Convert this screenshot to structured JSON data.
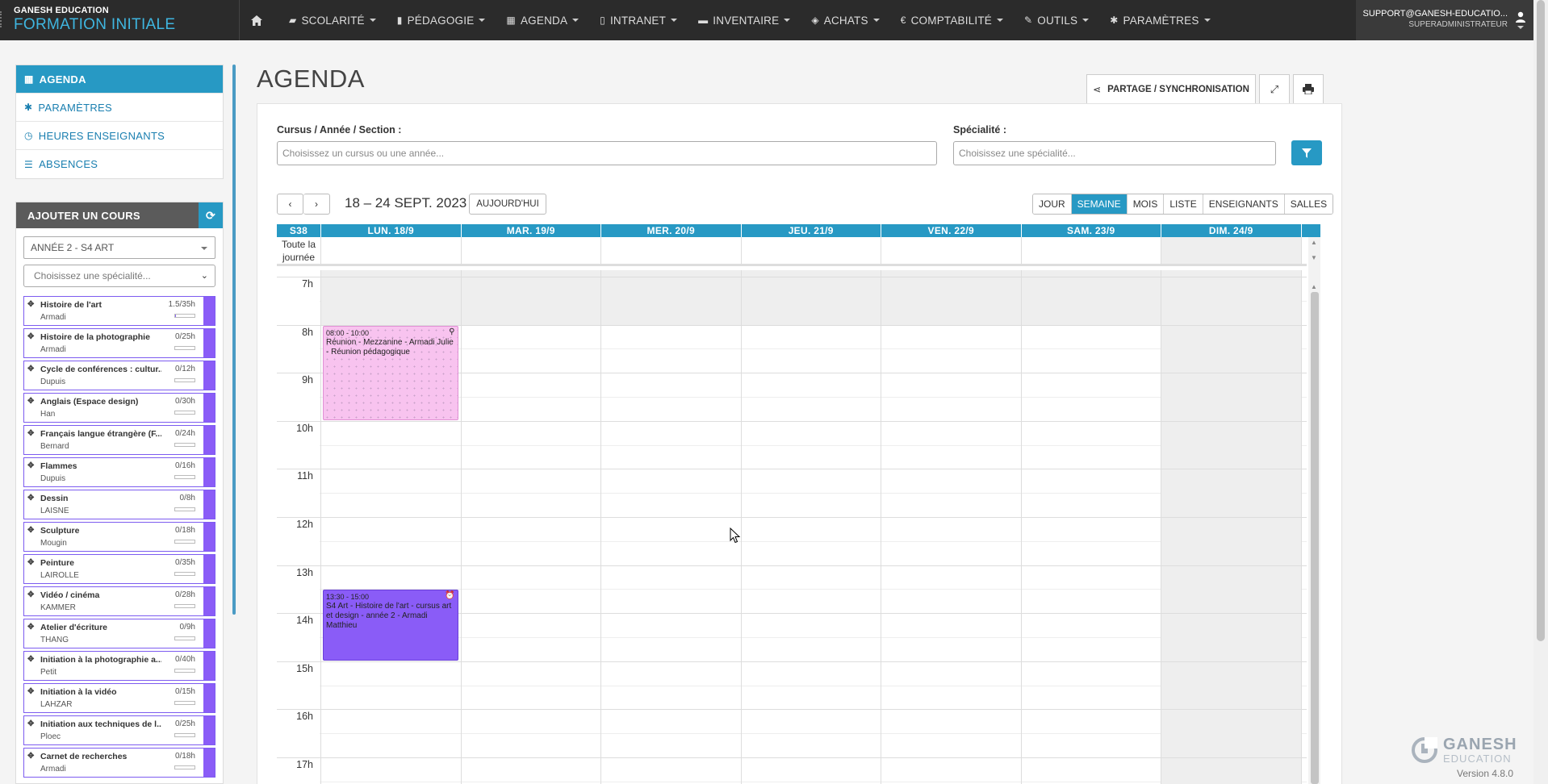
{
  "brand": {
    "top": "GANESH EDUCATION",
    "main": "FORMATION INITIALE"
  },
  "nav": [
    {
      "icon": "graduation-icon",
      "label": "SCOLARITÉ"
    },
    {
      "icon": "book-icon",
      "label": "PÉDAGOGIE"
    },
    {
      "icon": "calendar-icon",
      "label": "AGENDA"
    },
    {
      "icon": "document-icon",
      "label": "INTRANET"
    },
    {
      "icon": "folder-icon",
      "label": "INVENTAIRE"
    },
    {
      "icon": "tag-icon",
      "label": "ACHATS"
    },
    {
      "icon": "euro-icon",
      "label": "COMPTABILITÉ"
    },
    {
      "icon": "wrench-icon",
      "label": "OUTILS"
    },
    {
      "icon": "gear-icon",
      "label": "PARAMÈTRES"
    }
  ],
  "user": {
    "email": "SUPPORT@GANESH-EDUCATIO...",
    "role": "SUPERADMINISTRATEUR"
  },
  "left_menu": [
    {
      "icon": "calendar-icon",
      "label": "AGENDA",
      "active": true
    },
    {
      "icon": "gear-icon",
      "label": "PARAMÈTRES"
    },
    {
      "icon": "clock-icon",
      "label": "HEURES ENSEIGNANTS"
    },
    {
      "icon": "list-icon",
      "label": "ABSENCES"
    }
  ],
  "add_course": {
    "title": "AJOUTER UN COURS",
    "year_select": "ANNÉE 2 - S4 ART",
    "speciality_placeholder": "Choisissez une spécialité...",
    "courses": [
      {
        "name": "Histoire de l'art",
        "teacher": "Armadi",
        "hours": "1.5/35h",
        "progress": 0.04
      },
      {
        "name": "Histoire de la photographie",
        "teacher": "Armadi",
        "hours": "0/25h",
        "progress": 0
      },
      {
        "name": "Cycle de conférences : cultur...",
        "teacher": "Dupuis",
        "hours": "0/12h",
        "progress": 0
      },
      {
        "name": "Anglais (Espace design)",
        "teacher": "Han",
        "hours": "0/30h",
        "progress": 0
      },
      {
        "name": "Français langue étrangère (F...",
        "teacher": "Bernard",
        "hours": "0/24h",
        "progress": 0
      },
      {
        "name": "Flammes",
        "teacher": "Dupuis",
        "hours": "0/16h",
        "progress": 0
      },
      {
        "name": "Dessin",
        "teacher": "LAISNE",
        "hours": "0/8h",
        "progress": 0
      },
      {
        "name": "Sculpture",
        "teacher": "Mougin",
        "hours": "0/18h",
        "progress": 0
      },
      {
        "name": "Peinture",
        "teacher": "LAIROLLE",
        "hours": "0/35h",
        "progress": 0
      },
      {
        "name": "Vidéo / cinéma",
        "teacher": "KAMMER",
        "hours": "0/28h",
        "progress": 0
      },
      {
        "name": "Atelier d'écriture",
        "teacher": "THANG",
        "hours": "0/9h",
        "progress": 0
      },
      {
        "name": "Initiation à la photographie a...",
        "teacher": "Petit",
        "hours": "0/40h",
        "progress": 0
      },
      {
        "name": "Initiation à la vidéo",
        "teacher": "LAHZAR",
        "hours": "0/15h",
        "progress": 0
      },
      {
        "name": "Initiation aux techniques de l...",
        "teacher": "Ploec",
        "hours": "0/25h",
        "progress": 0
      },
      {
        "name": "Carnet de recherches",
        "teacher": "Armadi",
        "hours": "0/18h",
        "progress": 0
      }
    ]
  },
  "page": {
    "title": "AGENDA",
    "share_label": "PARTAGE / SYNCHRONISATION",
    "filters": {
      "cursus_label": "Cursus / Année / Section :",
      "cursus_placeholder": "Choisissez un cursus ou une année...",
      "speciality_label": "Spécialité :",
      "speciality_placeholder": "Choisissez une spécialité..."
    }
  },
  "calendar": {
    "range": "18 – 24 SEPT. 2023",
    "today_label": "AUJOURD'HUI",
    "views": [
      {
        "label": "JOUR"
      },
      {
        "label": "SEMAINE",
        "active": true
      },
      {
        "label": "MOIS"
      },
      {
        "label": "LISTE"
      },
      {
        "label": "ENSEIGNANTS"
      },
      {
        "label": "SALLES"
      }
    ],
    "week_label": "S38",
    "days": [
      "LUN. 18/9",
      "MAR. 19/9",
      "MER. 20/9",
      "JEU. 21/9",
      "VEN. 22/9",
      "SAM. 23/9",
      "DIM. 24/9"
    ],
    "all_day_label": "Toute la journée",
    "hours": [
      "7h",
      "8h",
      "9h",
      "10h",
      "11h",
      "12h",
      "13h",
      "14h",
      "15h",
      "16h",
      "17h"
    ],
    "events": [
      {
        "day": 0,
        "start": 8,
        "end": 10,
        "time": "08:00 - 10:00",
        "title": "Réunion - Mezzanine - Armadi Julie - Réunion pédagogique",
        "icon": "pin-icon",
        "color": "#f8c3ef"
      },
      {
        "day": 0,
        "start": 13.5,
        "end": 15,
        "time": "13:30 - 15:00",
        "title": "S4 Art - Histoire de l'art - cursus art et design - année 2 - Armadi Matthieu",
        "icon": "alarm-icon",
        "color": "#8a5cf7"
      }
    ]
  },
  "footer": {
    "logo_main": "GANESH",
    "logo_sub": "EDUCATION",
    "version": "Version 4.8.0"
  }
}
